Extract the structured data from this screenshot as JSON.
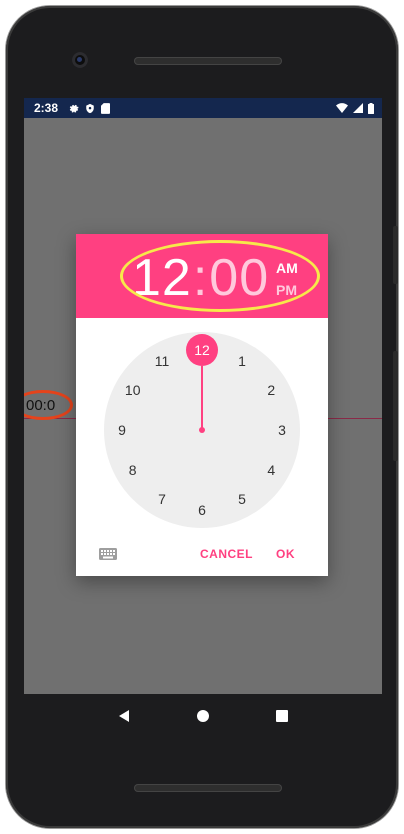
{
  "status_bar": {
    "time": "2:38",
    "left_icons": [
      "gear-icon",
      "shield-icon",
      "sd-card-icon"
    ],
    "right_icons": [
      "wifi-icon",
      "signal-icon",
      "battery-icon"
    ],
    "background": "#14274e"
  },
  "background": {
    "field_text": "00:0",
    "annotation_color": "#e5431b"
  },
  "dialog": {
    "header_color": "#ff4081",
    "hour": "12",
    "separator": ":",
    "minute": "00",
    "am_label": "AM",
    "pm_label": "PM",
    "highlight_color": "#f7e94a",
    "clock": {
      "numbers": [
        "12",
        "1",
        "2",
        "3",
        "4",
        "5",
        "6",
        "7",
        "8",
        "9",
        "10",
        "11"
      ],
      "selected": "12"
    },
    "keyboard_icon": "keyboard-icon",
    "cancel_label": "CANCEL",
    "ok_label": "OK"
  },
  "nav_bar": {
    "back_icon": "back-triangle-icon",
    "home_icon": "home-circle-icon",
    "recents_icon": "recents-square-icon"
  }
}
